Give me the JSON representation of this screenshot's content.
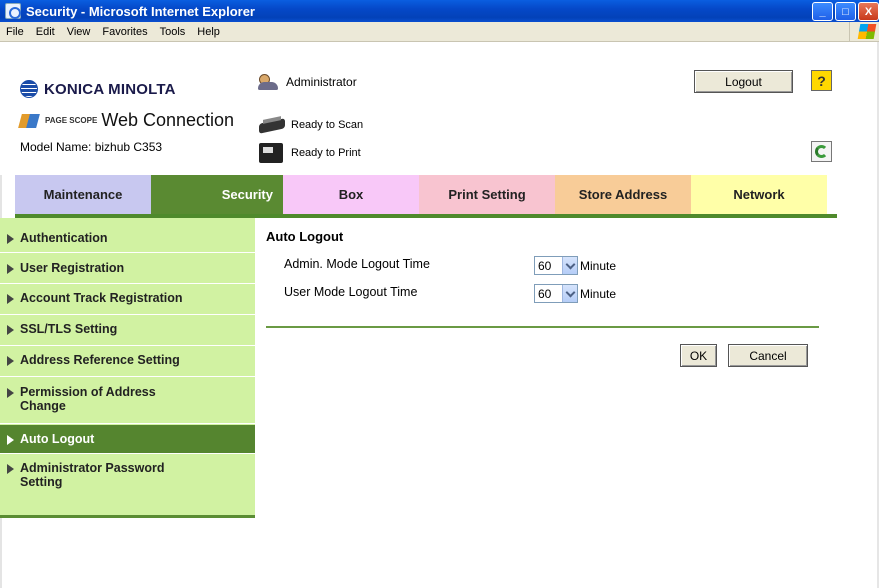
{
  "window": {
    "title": "Security - Microsoft Internet Explorer",
    "minimize": "_",
    "maximize": "□",
    "close": "X"
  },
  "menu": {
    "items": [
      "File",
      "Edit",
      "View",
      "Favorites",
      "Tools",
      "Help"
    ]
  },
  "header": {
    "brand": "KONICA MINOLTA",
    "product_small": "PAGE SCOPE",
    "product_name": "Web Connection",
    "model_label": "Model Name: bizhub C353",
    "user": "Administrator",
    "scan_status": "Ready to Scan",
    "print_status": "Ready to Print",
    "logout_label": "Logout",
    "help_label": "?"
  },
  "tabs": [
    {
      "label": "Maintenance",
      "color": "#c8c8f0",
      "active": false
    },
    {
      "label": "Security",
      "color": "#5a8a32",
      "active": true
    },
    {
      "label": "Box",
      "color": "#f8c8f8",
      "active": false
    },
    {
      "label": "Print Setting",
      "color": "#f8c4d0",
      "active": false
    },
    {
      "label": "Store Address",
      "color": "#f8cc98",
      "active": false
    },
    {
      "label": "Network",
      "color": "#ffffa8",
      "active": false
    }
  ],
  "sidebar": {
    "items": [
      {
        "label": "Authentication",
        "active": false
      },
      {
        "label": "User Registration",
        "active": false
      },
      {
        "label": "Account Track Registration",
        "active": false
      },
      {
        "label": "SSL/TLS Setting",
        "active": false
      },
      {
        "label": "Address Reference Setting",
        "active": false
      },
      {
        "label": "Permission of Address Change",
        "active": false
      },
      {
        "label": "Auto Logout",
        "active": true
      },
      {
        "label": "Administrator Password Setting",
        "active": false
      }
    ]
  },
  "main": {
    "title": "Auto Logout",
    "settings": [
      {
        "label": "Admin. Mode Logout Time",
        "value": "60",
        "unit": "Minute"
      },
      {
        "label": "User Mode Logout Time",
        "value": "60",
        "unit": "Minute"
      }
    ],
    "ok_label": "OK",
    "cancel_label": "Cancel"
  },
  "colors": {
    "nav_bg": "#d1f2a2",
    "nav_active": "#55852f",
    "accent_line": "#4f8a2c"
  }
}
